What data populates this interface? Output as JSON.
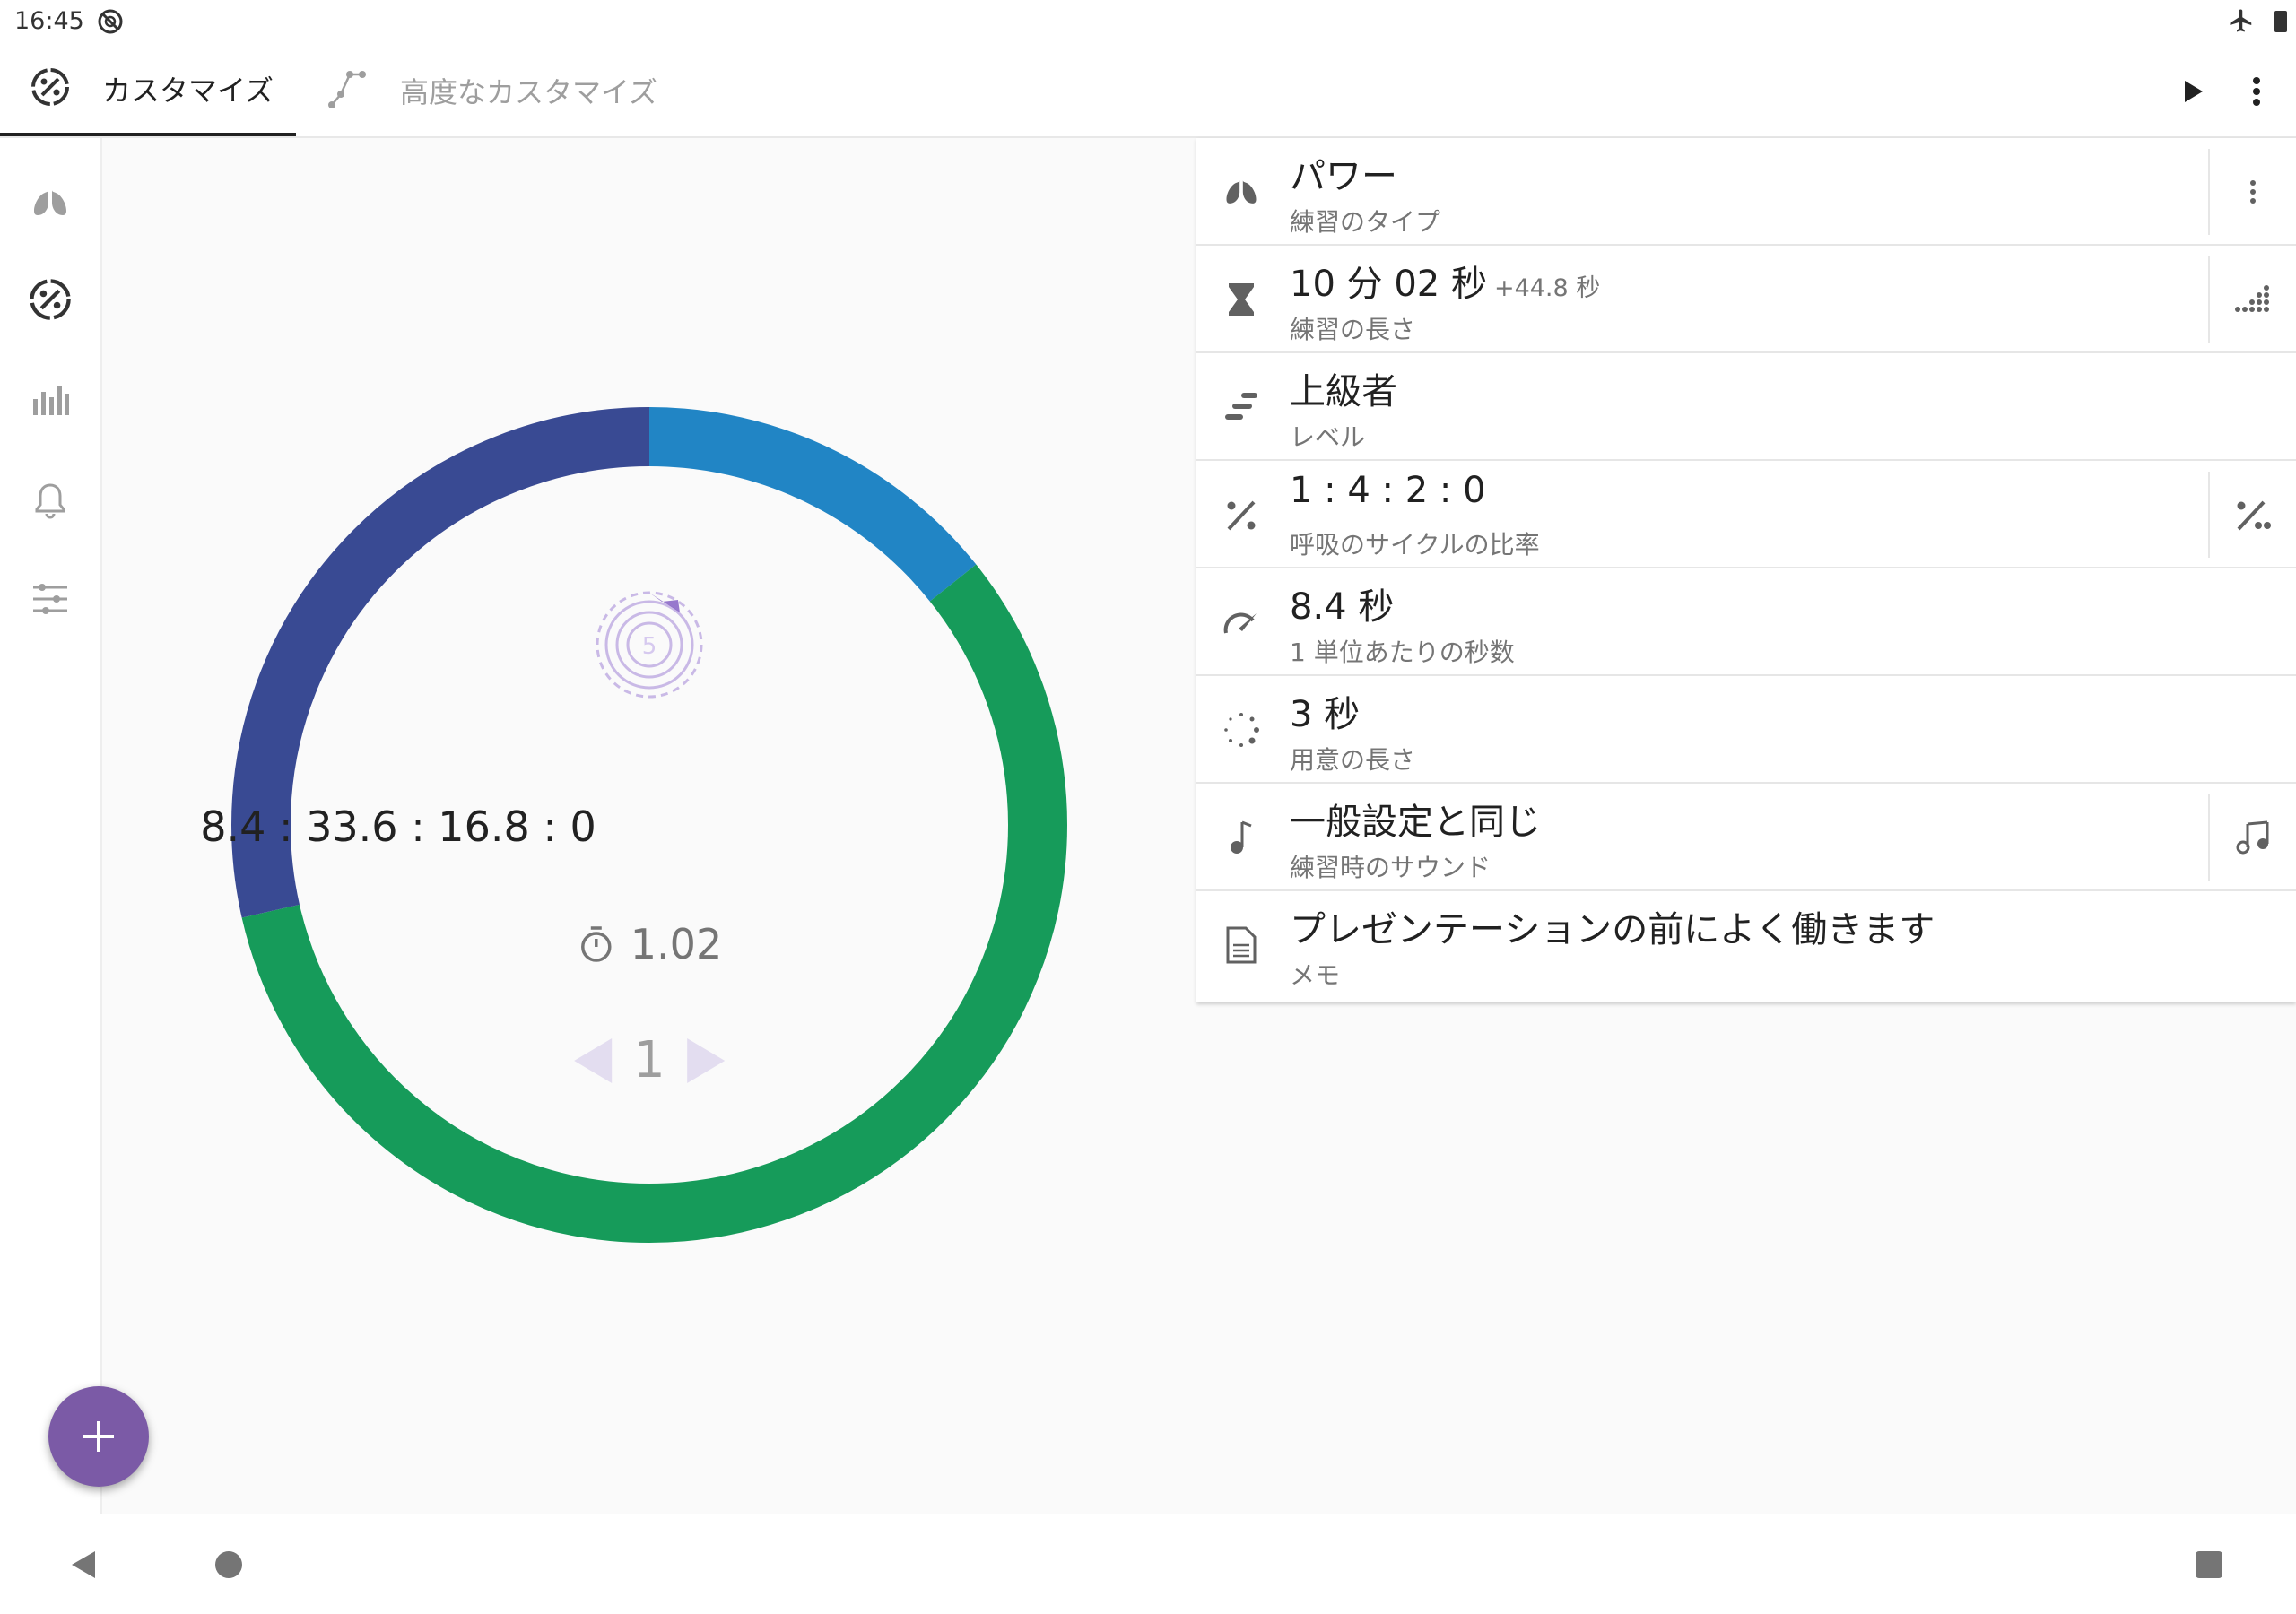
{
  "status_bar": {
    "time": "16:45"
  },
  "tabs": [
    {
      "label": "カスタマイズ",
      "icon": "breath-ratio-icon",
      "active": true
    },
    {
      "label": "高度なカスタマイズ",
      "icon": "graph-nodes-icon",
      "active": false
    }
  ],
  "toolbar": {
    "play_icon": "play-icon",
    "more_icon": "more-vert-icon"
  },
  "side_rail": [
    {
      "name": "lungs-icon"
    },
    {
      "name": "breath-ratio-icon"
    },
    {
      "name": "bar-chart-icon"
    },
    {
      "name": "bell-icon"
    },
    {
      "name": "sliders-icon"
    }
  ],
  "visualizer": {
    "ratio_text": "8.4 : 33.6 : 16.8 : 0",
    "duration_text": "1.02",
    "cycle_number": "1",
    "mandala_number": "5",
    "ring_segments": [
      {
        "phase": "inhale",
        "value": 8.4,
        "color": "#2185c5"
      },
      {
        "phase": "hold",
        "value": 33.6,
        "color": "#169b5a"
      },
      {
        "phase": "exhale",
        "value": 16.8,
        "color": "#394a93"
      },
      {
        "phase": "hold-after",
        "value": 0,
        "color": "#2185c5"
      }
    ]
  },
  "settings": [
    {
      "key": "type",
      "icon": "lungs-icon",
      "title": "パワー",
      "extra": "",
      "subtitle": "練習のタイプ",
      "action": "more-vert-icon"
    },
    {
      "key": "length",
      "icon": "hourglass-icon",
      "title": "10 分 02 秒",
      "extra": "+44.8 秒",
      "subtitle": "練習の長さ",
      "action": "dots-grid-icon"
    },
    {
      "key": "level",
      "icon": "level-steps-icon",
      "title": "上級者",
      "extra": "",
      "subtitle": "レベル",
      "action": ""
    },
    {
      "key": "ratio",
      "icon": "percent-icon",
      "title": "1 : 4 : 2 : 0",
      "extra": "",
      "subtitle": "呼吸のサイクルの比率",
      "action": "ratio-icon"
    },
    {
      "key": "unit",
      "icon": "speedometer-icon",
      "title": "8.4 秒",
      "extra": "",
      "subtitle": "1 単位あたりの秒数",
      "action": ""
    },
    {
      "key": "prepare",
      "icon": "spinner-dots-icon",
      "title": "3 秒",
      "extra": "",
      "subtitle": "用意の長さ",
      "action": ""
    },
    {
      "key": "sound",
      "icon": "music-note-icon",
      "title": "一般設定と同じ",
      "extra": "",
      "subtitle": "練習時のサウンド",
      "action": "music-notes-icon"
    },
    {
      "key": "memo",
      "icon": "document-icon",
      "title": "プレゼンテーションの前によく働きます",
      "extra": "",
      "subtitle": "メモ",
      "action": ""
    }
  ],
  "fab": {
    "icon": "plus-icon"
  },
  "colors": {
    "accent": "#7b5aa6",
    "inhale": "#2185c5",
    "hold": "#169b5a",
    "exhale": "#394a93"
  }
}
